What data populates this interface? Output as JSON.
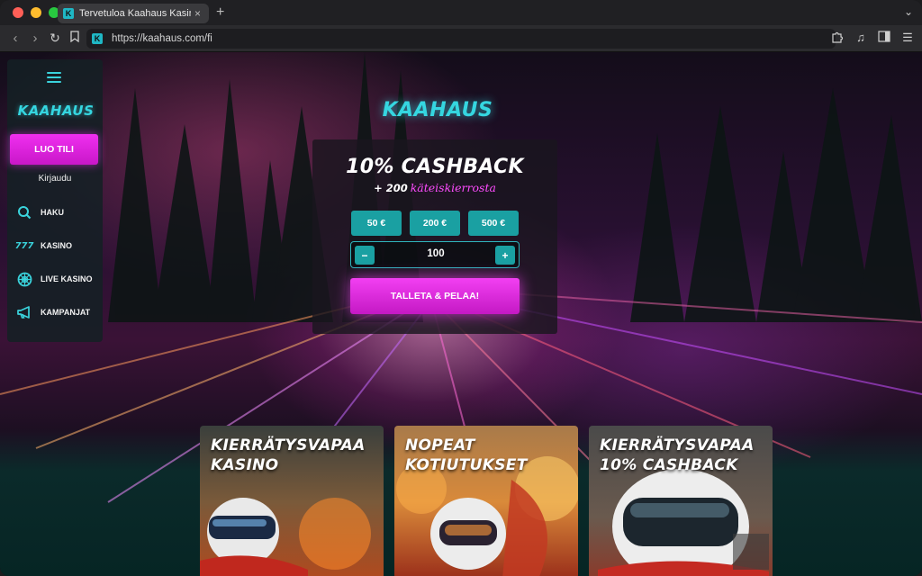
{
  "browser": {
    "tab_title": "Tervetuloa Kaahaus Kasinolle",
    "favicon_letter": "K",
    "new_tab": "+",
    "tab_close": "×",
    "url": "https://kaahaus.com/fi"
  },
  "sidebar": {
    "logo": "KAAHAUS",
    "register_label": "LUO TILI",
    "login_label": "Kirjaudu",
    "items": [
      {
        "label": "HAKU",
        "icon": "search-icon"
      },
      {
        "label": "KASINO",
        "icon": "slot-777-icon"
      },
      {
        "label": "LIVE KASINO",
        "icon": "roulette-icon"
      },
      {
        "label": "KAMPANJAT",
        "icon": "megaphone-icon"
      }
    ]
  },
  "hero": {
    "logo": "KAAHAUS",
    "title": "10% CASHBACK",
    "subtitle_prefix": "+ 200",
    "subtitle_script": "käteiskierrosta",
    "amounts": [
      "50 €",
      "200 €",
      "500 €"
    ],
    "stepper_value": "100",
    "minus": "−",
    "plus": "+",
    "deposit_label": "TALLETA & PELAA!"
  },
  "promos": [
    {
      "line1": "KIERRÄTYSVAPAA",
      "line2": "KASINO"
    },
    {
      "line1": "NOPEAT",
      "line2": "KOTIUTUKSET"
    },
    {
      "line1": "KIERRÄTYSVAPAA",
      "line2": "10% CASHBACK"
    }
  ],
  "colors": {
    "accent_cyan": "#35d6e0",
    "accent_magenta": "#f02ff0",
    "amount_button": "#1aa0a2"
  }
}
